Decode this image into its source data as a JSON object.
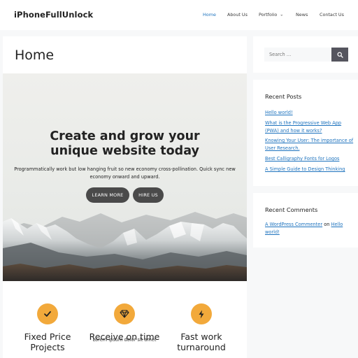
{
  "header": {
    "site_title": "iPhoneFullUnlock",
    "nav": [
      {
        "label": "Home"
      },
      {
        "label": "About Us"
      },
      {
        "label": "Portfolio"
      },
      {
        "label": "News"
      },
      {
        "label": "Contact Us"
      }
    ],
    "nav_active_color": "#1e73be"
  },
  "main": {
    "page_title": "Home",
    "hero": {
      "heading_line1": "Create and grow your",
      "heading_line2": "unique website today",
      "text": "Programmatically work but low hanging fruit so new economy cross-pollination. Quick sync new economy onward and upward.",
      "learn_more_label": "LEARN MORE",
      "hire_us_label": "HIRE US"
    },
    "features": [
      {
        "icon": "checkmark-icon",
        "title_line1": "Fixed Price",
        "title_line2": "Projects",
        "text": ""
      },
      {
        "icon": "diamond-icon",
        "title_line1": "Receive on time",
        "title_line2": "",
        "text": "Lorem ipsum dolor sit amet"
      },
      {
        "icon": "lightning-icon",
        "title_line1": "Fast work",
        "title_line2": "turnaround",
        "text": ""
      }
    ],
    "feature_icon_color": "#f2a93b",
    "button_color": "#4a4a4a"
  },
  "sidebar": {
    "search": {
      "placeholder": "Search …"
    },
    "recent_posts": {
      "title": "Recent Posts",
      "posts": [
        "Hello world!",
        "What is the Progressive Web App (PWA) and how it works?",
        "Knowing Your User: The importance of User Research.",
        "Best Calligraphy Fonts for Logos",
        "A Simple Guide to Design Thinking"
      ]
    },
    "recent_comments": {
      "title": "Recent Comments",
      "author": "A WordPress Commenter",
      "on": "on",
      "post": "Hello world!"
    }
  }
}
